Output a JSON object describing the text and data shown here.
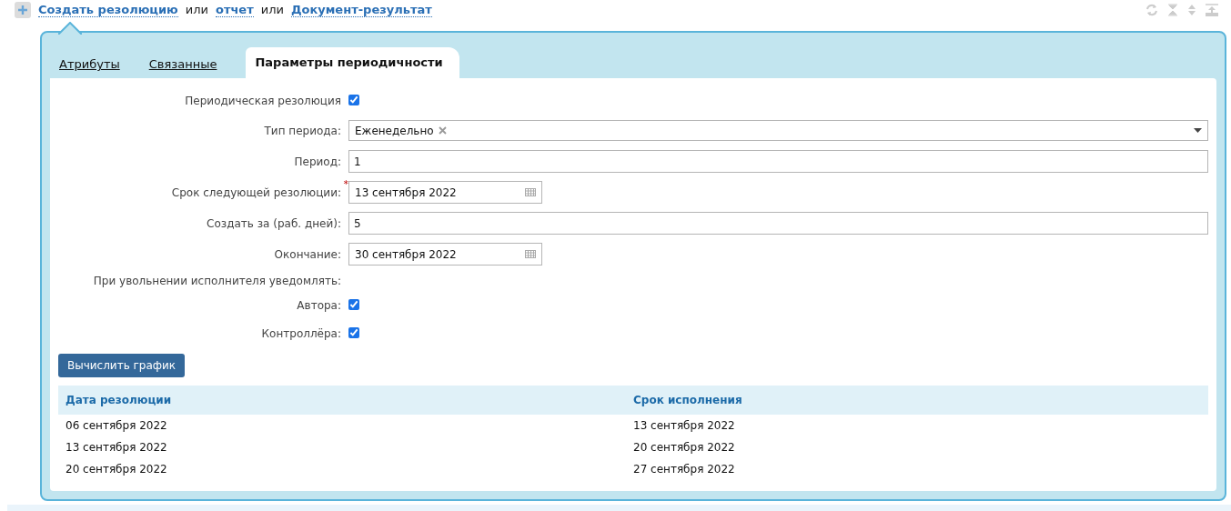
{
  "actions": [
    {
      "kind": "link",
      "text": "Создать резолюцию"
    },
    {
      "kind": "plain",
      "text": "или"
    },
    {
      "kind": "link",
      "text": "отчет"
    },
    {
      "kind": "plain",
      "text": "или"
    },
    {
      "kind": "link",
      "text": "Документ-результат"
    }
  ],
  "tabs": [
    {
      "label": "Атрибуты",
      "selected": false
    },
    {
      "label": "Связанные",
      "selected": false
    },
    {
      "label": "Параметры периодичности",
      "selected": true
    }
  ],
  "fields": [
    {
      "kind": "checkbox",
      "label": "Периодическая резолюция",
      "checked": true
    },
    {
      "kind": "select",
      "label": "Тип периода:",
      "value": "Еженедельно"
    },
    {
      "kind": "text",
      "label": "Период:",
      "value": "1"
    },
    {
      "kind": "date",
      "label": "Срок следующей резолюции:",
      "value": "13 сентября 2022",
      "required_mark": "*"
    },
    {
      "kind": "text",
      "label": "Создать за (раб. дней):",
      "value": "5"
    },
    {
      "kind": "date",
      "label": "Окончание:",
      "value": "30 сентября 2022"
    },
    {
      "kind": "heading",
      "label": "При увольнении исполнителя уведомлять:"
    },
    {
      "kind": "checkbox",
      "label": "Автора:",
      "checked": true
    },
    {
      "kind": "checkbox",
      "label": "Контроллёра:",
      "checked": true
    }
  ],
  "compute_button": "Вычислить график",
  "table": {
    "columns": [
      "Дата резолюции",
      "Срок исполнения"
    ],
    "rows": [
      [
        "06 сентября 2022",
        "13 сентября 2022"
      ],
      [
        "13 сентября 2022",
        "20 сентября 2022"
      ],
      [
        "20 сентября 2022",
        "27 сентября 2022"
      ]
    ]
  }
}
